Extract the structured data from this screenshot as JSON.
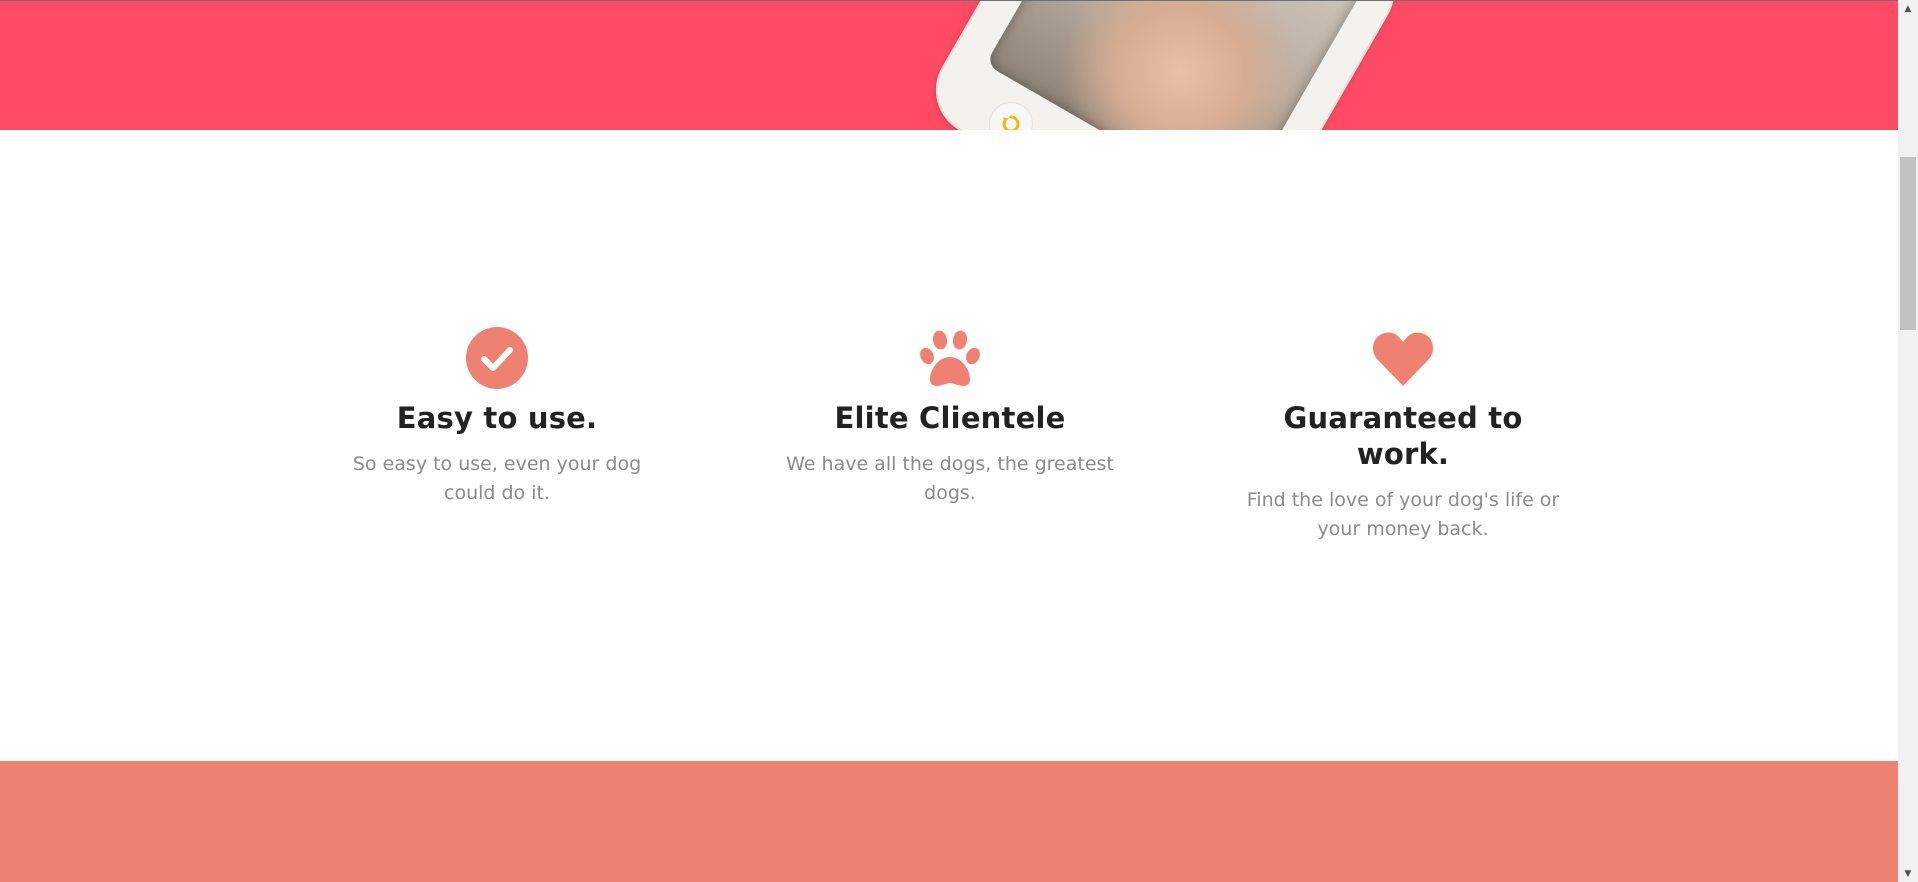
{
  "colors": {
    "hero_background": "#ff4a66",
    "accent": "#ef8172",
    "heading_text": "#222222",
    "body_text": "#8b8b8b"
  },
  "hero": {
    "image": "phone-with-dog-screen"
  },
  "features": [
    {
      "icon": "check-circle-icon",
      "title": "Easy to use.",
      "text": "So easy to use, even your dog could do it."
    },
    {
      "icon": "paw-icon",
      "title": "Elite Clientele",
      "text": "We have all the dogs, the greatest dogs."
    },
    {
      "icon": "heart-icon",
      "title": "Guaranteed to work.",
      "text": "Find the love of your dog's life or your money back."
    }
  ],
  "scrollbar": {
    "up_glyph": "▲",
    "down_glyph": "▼"
  }
}
